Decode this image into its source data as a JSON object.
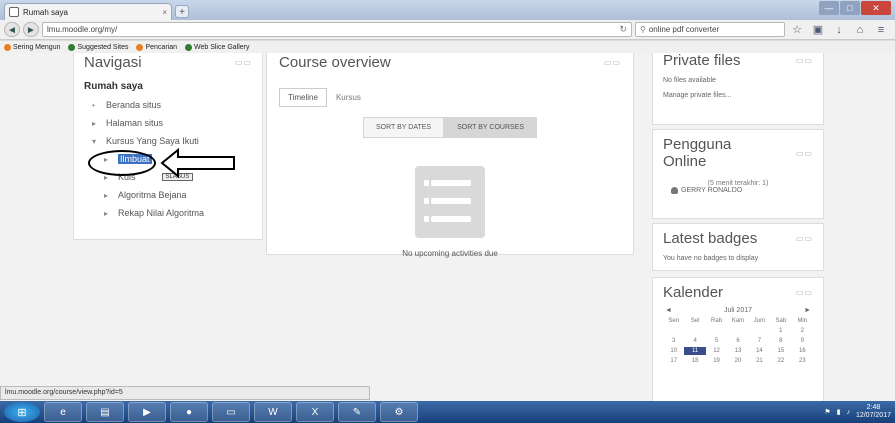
{
  "browser": {
    "tab_title": "Rumah saya",
    "tab_close": "×",
    "new_tab": "+",
    "url": "lmu.moodle.org/my/",
    "search_value": "online pdf converter",
    "win_min": "—",
    "win_max": "□",
    "win_close": "✕"
  },
  "bookmarks": [
    "Sering Mengun",
    "Suggested Sites",
    "Pencarian",
    "Web Slice Gallery"
  ],
  "navigation": {
    "title": "Navigasi",
    "control": "▭▭",
    "items": [
      {
        "label": "Rumah saya"
      },
      {
        "label": "Beranda situs"
      },
      {
        "label": "Halaman situs"
      },
      {
        "label": "Kursus Yang Saya Ikuti"
      },
      {
        "label": "Ilmbuat"
      },
      {
        "label": "Kuis"
      },
      {
        "label": "Algoritma Bejana"
      },
      {
        "label": "Rekap Nilai Algoritma"
      }
    ],
    "badge": "SLASUS"
  },
  "course_overview": {
    "title": "Course overview",
    "control": "▭▭",
    "tabs": [
      "Timeline",
      "Kursus"
    ],
    "sort_dates": "SORT BY DATES",
    "sort_courses": "SORT BY COURSES",
    "empty_text": "No upcoming activities due"
  },
  "private_files": {
    "title": "Private files",
    "control": "▭▭",
    "empty": "No files available",
    "manage": "Manage private files..."
  },
  "online_users": {
    "title": "Pengguna Online",
    "control": "▭▭",
    "count": "(5 menit terakhir: 1)",
    "user": "GERRY RONALDO"
  },
  "badges": {
    "title": "Latest badges",
    "control": "▭▭",
    "text": "You have no badges to display"
  },
  "calendar": {
    "title": "Kalender",
    "control": "▭▭",
    "month": "Juli 2017",
    "prev": "◄",
    "next": "►",
    "days": [
      "Sen",
      "Sel",
      "Rab",
      "Kam",
      "Jum",
      "Sab",
      "Min"
    ],
    "cells": [
      "",
      "",
      "",
      "",
      "",
      "1",
      "2",
      "3",
      "4",
      "5",
      "6",
      "7",
      "8",
      "9",
      "10",
      "11",
      "12",
      "13",
      "14",
      "15",
      "16",
      "17",
      "18",
      "19",
      "20",
      "21",
      "22",
      "23"
    ],
    "today": "11"
  },
  "statusbar": "lmu.moodle.org/course/view.php?id=5",
  "taskbar": {
    "time": "2:48",
    "date": "12/07/2017"
  }
}
